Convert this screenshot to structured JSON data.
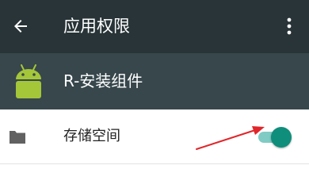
{
  "toolbar": {
    "title": "应用权限",
    "back_icon": "arrow-left-icon",
    "overflow_icon": "more-vertical-icon"
  },
  "app": {
    "name": "R-安装组件",
    "icon": "android-icon"
  },
  "permission": {
    "label": "存储空间",
    "icon": "folder-icon",
    "enabled": true
  },
  "colors": {
    "toolbar": "#283437",
    "app_header": "#37474c",
    "switch_thumb": "#0e8e7b",
    "switch_track": "#80cbc4",
    "android_green": "#a4c639",
    "annotation_arrow": "#e0262a"
  }
}
